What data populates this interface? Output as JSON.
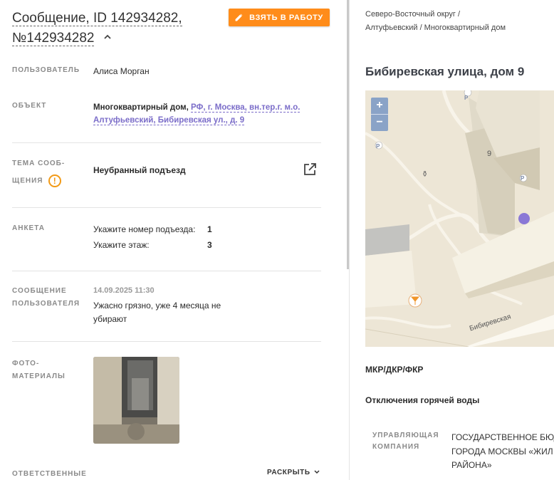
{
  "header": {
    "title": "Сообщение, ID 142934282, №142934282",
    "take_button": "ВЗЯТЬ В РАБОТУ"
  },
  "fields": {
    "user_label": "ПОЛЬЗОВАТЕЛЬ",
    "user_value": "Алиса Морган",
    "object_label": "ОБЪЕКТ",
    "object_type": "Многоквартирный дом,",
    "object_link": "РФ, г. Москва, вн.тер.г. м.о. Алтуфьевский, Бибиревская ул., д. 9",
    "topic_label_1": "ТЕМА СООБ-",
    "topic_label_2": "ЩЕНИЯ",
    "topic_value": "Неубранный подъезд",
    "survey_label": "АНКЕТА",
    "survey": [
      {
        "question": "Укажите номер подъезда:",
        "answer": "1"
      },
      {
        "question": "Укажите этаж:",
        "answer": "3"
      }
    ],
    "message_label_1": "СООБЩЕНИЕ",
    "message_label_2": "ПОЛЬЗОВАТЕЛЯ",
    "message_date": "14.09.2025 11:30",
    "message_text": "Ужасно грязно, уже 4 месяца не убирают",
    "photo_label_1": "ФОТО-",
    "photo_label_2": "МАТЕРИАЛЫ",
    "responsible_label": "ОТВЕТСТВЕННЫЕ",
    "expand_label": "РАСКРЫТЬ"
  },
  "right": {
    "breadcrumb": "Северо-Восточный округ / Алтуфьевский / Многоквартирный дом",
    "address": "Бибиревская улица, дом 9",
    "map": {
      "zoom_in": "+",
      "zoom_out": "−",
      "building_number": "9",
      "street_label": "Бибиревская",
      "parking_label": "P"
    },
    "section_mkr": "МКР/ДКР/ФКР",
    "section_hot_water": "Отключения горячей воды",
    "mgmt_label_1": "УПРАВЛЯЮЩАЯ",
    "mgmt_label_2": "КОМПАНИЯ",
    "mgmt_value_1": "ГОСУДАРСТВЕННОЕ БЮД",
    "mgmt_value_2": "ГОРОДА МОСКВЫ «ЖИЛ",
    "mgmt_value_3": "РАЙОНА»"
  },
  "colors": {
    "accent": "#ff8c1a",
    "link": "#7b6dc9",
    "warning": "#f29a16",
    "map_marker": "#8a78d6"
  }
}
